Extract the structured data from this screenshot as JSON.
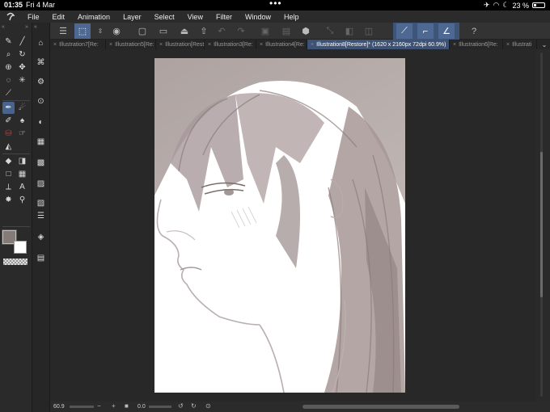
{
  "status_bar": {
    "time": "01:35",
    "date": "Fri 4 Mar",
    "battery": "23 %"
  },
  "menu": {
    "items": [
      "File",
      "Edit",
      "Animation",
      "Layer",
      "Select",
      "View",
      "Filter",
      "Window",
      "Help"
    ]
  },
  "tabs": [
    {
      "label": "Illustration7[Re:",
      "active": false
    },
    {
      "label": "Illustration5[Re:",
      "active": false
    },
    {
      "label": "Illustration[Rest",
      "active": false
    },
    {
      "label": "Illustration3[Re:",
      "active": false
    },
    {
      "label": "Illustration4[Re:",
      "active": false
    },
    {
      "label": "Illustration8[Restore]* (1620 x 2160px 72dpi 60.9%)",
      "active": true
    },
    {
      "label": "Illustration6[Re:",
      "active": false
    },
    {
      "label": "Illustrati",
      "active": false
    }
  ],
  "bottom_bar": {
    "zoom": "60.9",
    "angle": "0.0"
  },
  "colors": {
    "accent": "#4d6892",
    "main_color": "#847a78",
    "sub_color": "#ffffff"
  }
}
